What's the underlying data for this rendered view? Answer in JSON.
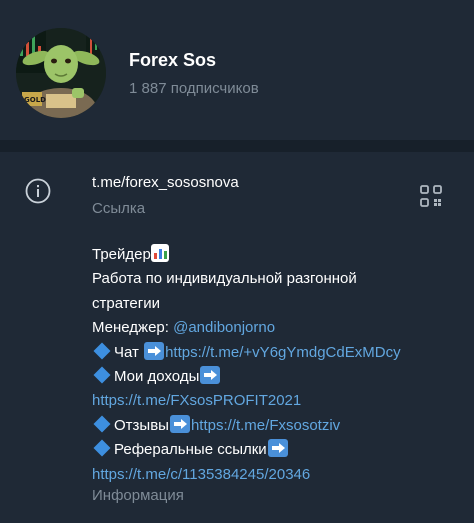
{
  "channel": {
    "name": "Forex Sos",
    "subscribers": "1 887 подписчиков"
  },
  "link": {
    "url": "t.me/forex_sososnova",
    "caption": "Ссылка"
  },
  "description": {
    "line1": "Трейдер",
    "line2": "Работа по индивидуальной разгонной",
    "line3": "стратегии",
    "manager_label": "Менеджер: ",
    "manager_handle": "@andibonjorno",
    "chat_label": "Чат ",
    "chat_link": "https://t.me/+vY6gYmdgCdExMDcy",
    "income_label": "Мои доходы",
    "income_link": "https://t.me/FXsosPROFIT2021",
    "reviews_label": "Отзывы",
    "reviews_link": "https://t.me/Fxsosotziv",
    "referral_label": "Реферальные ссылки",
    "referral_link": "https://t.me/c/1135384245/20346"
  },
  "info_caption": "Информация",
  "avatar": {
    "sign_text": "GOLD"
  },
  "icons": {
    "info": "info-circle-icon",
    "qr": "qr-code-icon",
    "chart": "bar-chart-emoji",
    "diamond": "blue-diamond-emoji",
    "arrow": "right-arrow-emoji"
  },
  "colors": {
    "background": "#1f2936",
    "divider": "#17202a",
    "secondary_text": "#7f8b97",
    "link": "#62a7e0",
    "diamond": "#3d8fe0"
  }
}
